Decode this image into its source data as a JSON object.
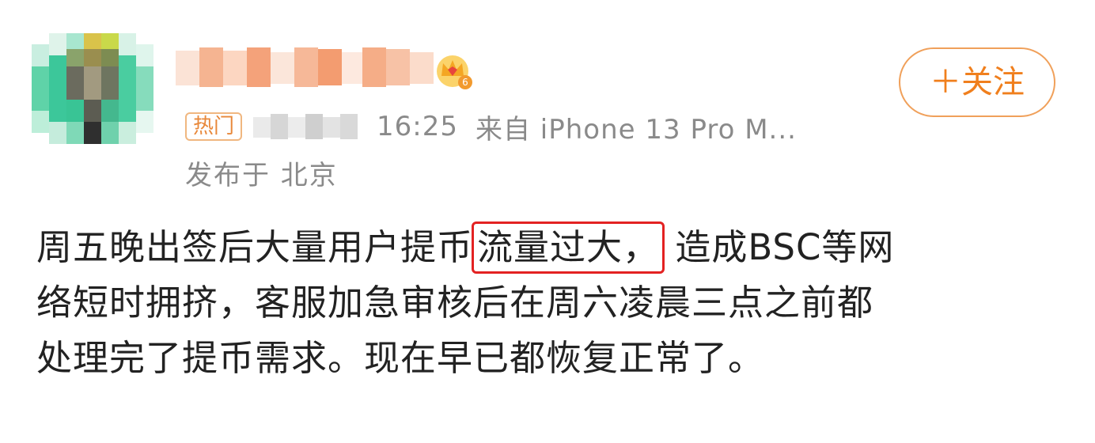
{
  "post": {
    "follow_label": "＋关注",
    "hot_tag": "热门",
    "time": "16:25",
    "source": "来自 iPhone 13 Pro M...",
    "location": "发布于 北京",
    "badge_level": "6",
    "content": {
      "line1_before": "周五晚出签后大量用户提币",
      "line1_highlight": "流量过大，",
      "line1_after": " 造成BSC等网",
      "line2": "络短时拥挤，客服加急审核后在周六凌晨三点之前都",
      "line3": "处理完了提币需求。现在早已都恢复正常了。"
    }
  },
  "colors": {
    "accent_orange": "#f07f1d",
    "highlight_red": "#e32222",
    "meta_gray": "#8a8a8a"
  },
  "icons": {
    "avatar": "pixelated-avatar",
    "badge": "crown-badge-icon"
  }
}
